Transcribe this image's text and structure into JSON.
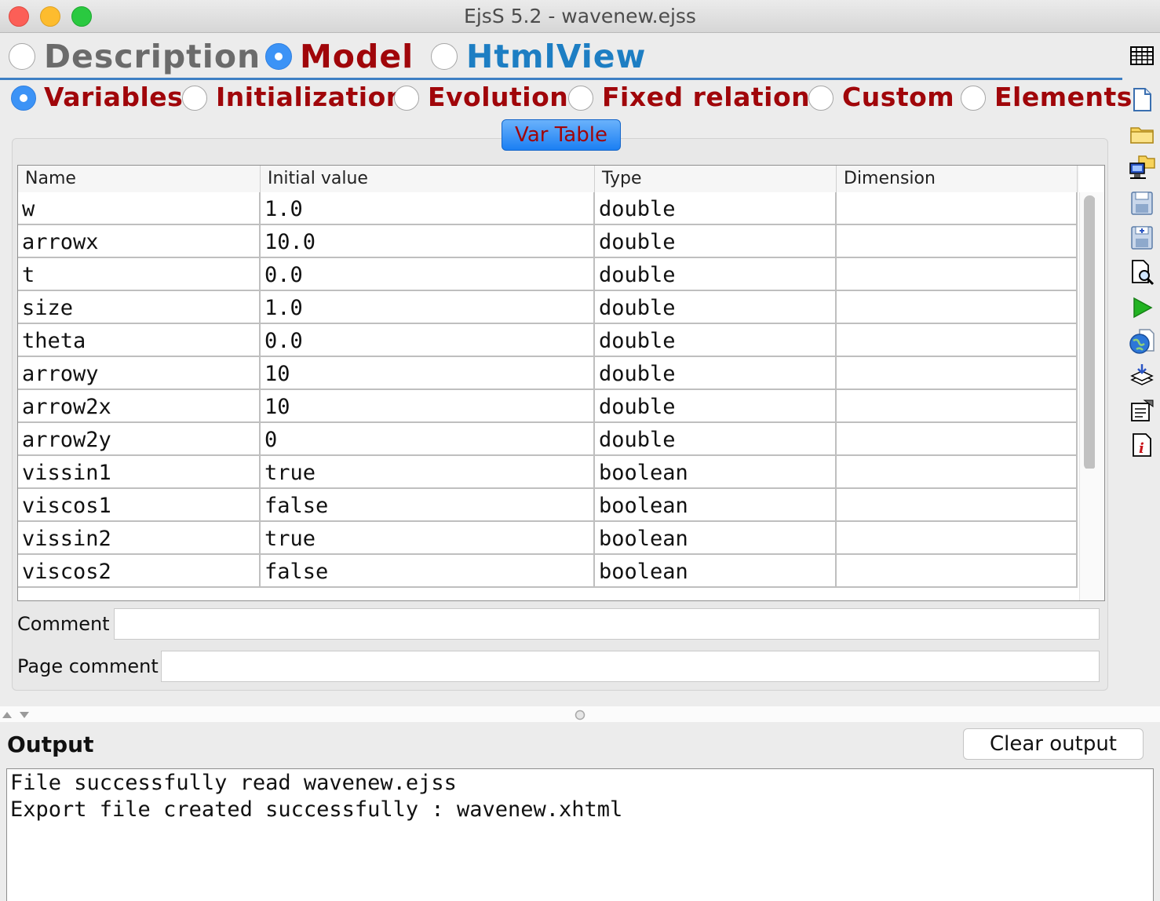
{
  "window": {
    "title": "EjsS 5.2 - wavenew.ejss"
  },
  "main_tabs": [
    {
      "label": "Description",
      "selected": false,
      "color": "#6b6b6b"
    },
    {
      "label": "Model",
      "selected": true,
      "color": "#a0060a"
    },
    {
      "label": "HtmlView",
      "selected": false,
      "color": "#1d7ec3"
    }
  ],
  "sub_tabs": [
    {
      "label": "Variables",
      "selected": true
    },
    {
      "label": "Initialization",
      "selected": false
    },
    {
      "label": "Evolution",
      "selected": false
    },
    {
      "label": "Fixed relations",
      "selected": false
    },
    {
      "label": "Custom",
      "selected": false
    },
    {
      "label": "Elements",
      "selected": false
    }
  ],
  "var_table_button": "Var Table",
  "table": {
    "columns": [
      "Name",
      "Initial value",
      "Type",
      "Dimension"
    ],
    "rows": [
      [
        "w",
        "1.0",
        "double",
        ""
      ],
      [
        "arrowx",
        "10.0",
        "double",
        ""
      ],
      [
        "t",
        "0.0",
        "double",
        ""
      ],
      [
        "size",
        "1.0",
        "double",
        ""
      ],
      [
        "theta",
        "0.0",
        "double",
        ""
      ],
      [
        "arrowy",
        "10",
        "double",
        ""
      ],
      [
        "arrow2x",
        "10",
        "double",
        ""
      ],
      [
        "arrow2y",
        "0",
        "double",
        ""
      ],
      [
        "vissin1",
        "true",
        "boolean",
        ""
      ],
      [
        "viscos1",
        "false",
        "boolean",
        ""
      ],
      [
        "vissin2",
        "true",
        "boolean",
        ""
      ],
      [
        "viscos2",
        "false",
        "boolean",
        ""
      ]
    ]
  },
  "comment_label": "Comment",
  "comment_value": "",
  "page_comment_label": "Page comment",
  "page_comment_value": "",
  "output": {
    "title": "Output",
    "clear_label": "Clear output",
    "lines": [
      "File successfully read wavenew.ejss",
      "Export file created successfully : wavenew.xhtml"
    ]
  },
  "toolbar_icons": [
    "table-view-icon",
    "new-file-icon",
    "open-folder-icon",
    "open-workspace-icon",
    "save-icon",
    "save-as-icon",
    "search-document-icon",
    "run-icon",
    "web-export-icon",
    "package-icon",
    "preferences-icon",
    "info-icon"
  ]
}
